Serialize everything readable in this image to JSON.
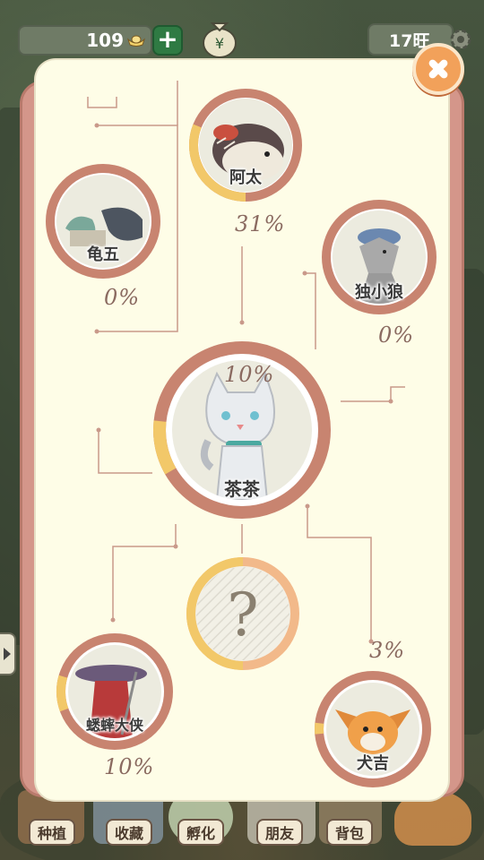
{
  "top_bar": {
    "coins": "109",
    "plus_label": "+",
    "vigor": "17旺"
  },
  "nav": {
    "items": [
      {
        "label": "种植"
      },
      {
        "label": "收藏"
      },
      {
        "label": "孵化"
      },
      {
        "label": "朋友"
      },
      {
        "label": "背包"
      }
    ]
  },
  "relations": {
    "center": {
      "name": "茶茶",
      "percent": "10%",
      "progress": 0.1
    },
    "characters": [
      {
        "name": "阿太",
        "percent": "31%",
        "progress": 0.31
      },
      {
        "name": "龟五",
        "percent": "0%",
        "progress": 0.0
      },
      {
        "name": "独小狼",
        "percent": "0%",
        "progress": 0.0
      },
      {
        "name": "蟋蟀大侠",
        "percent": "10%",
        "progress": 0.1
      },
      {
        "name": "犬吉",
        "percent": "3%",
        "progress": 0.03
      }
    ],
    "locked": {
      "symbol": "?"
    }
  },
  "colors": {
    "ring": "#c88470",
    "ring_track": "#d9a592",
    "progress": "#f2c869",
    "panel": "#fefde7",
    "line": "#c9998a"
  }
}
